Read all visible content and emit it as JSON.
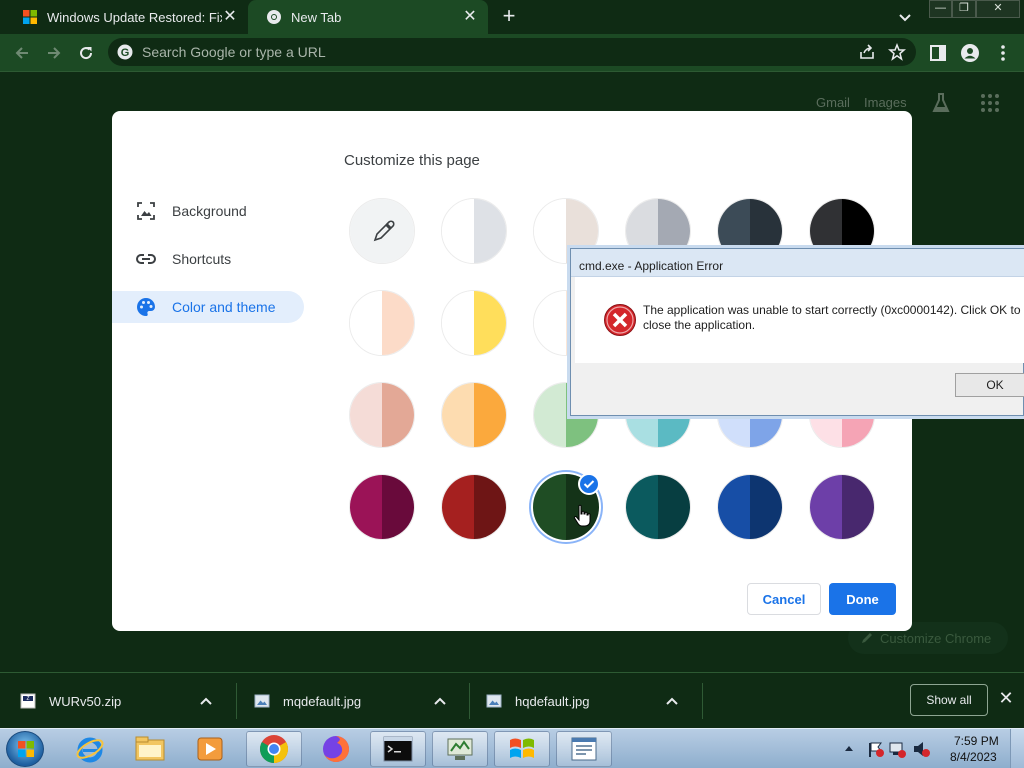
{
  "browser": {
    "tabs": [
      {
        "title": "Windows Update Restored: Fix W",
        "active": false
      },
      {
        "title": "New Tab",
        "active": true
      }
    ],
    "window_controls": {
      "minimize": "—",
      "maximize": "❐",
      "close": "✕"
    },
    "omnibox": {
      "placeholder": "Search Google or type a URL"
    }
  },
  "ntp": {
    "gmail": "Gmail",
    "images": "Images",
    "customize_chrome": "Customize Chrome"
  },
  "customize_dialog": {
    "title": "Customize this page",
    "nav": [
      {
        "label": "Background",
        "icon": "image-icon",
        "selected": false
      },
      {
        "label": "Shortcuts",
        "icon": "link-icon",
        "selected": false
      },
      {
        "label": "Color and theme",
        "icon": "palette-icon",
        "selected": true
      }
    ],
    "swatches": [
      {
        "left": "#f1f3f4",
        "right": "#f1f3f4",
        "custom": true
      },
      {
        "left": "#ffffff",
        "right": "#dee1e6"
      },
      {
        "left": "#ffffff",
        "right": "#e9e0da"
      },
      {
        "left": "#dadce0",
        "right": "#a4a9b3"
      },
      {
        "left": "#3c4b57",
        "right": "#28323a"
      },
      {
        "left": "#303134",
        "right": "#000000"
      },
      {
        "left": "#ffffff",
        "right": "#fcdbc8"
      },
      {
        "left": "#ffffff",
        "right": "#ffde5b"
      },
      {
        "left": "#ffffff",
        "right": "#fbe7d8"
      },
      {
        "left": "#ffffff",
        "right": "#cde3f5"
      },
      {
        "left": "#ffffff",
        "right": "#d3e2fb"
      },
      {
        "left": "#ffffff",
        "right": "#fde0e6"
      },
      {
        "left": "#f5dcd7",
        "right": "#e3a896"
      },
      {
        "left": "#fddcb0",
        "right": "#fba93d"
      },
      {
        "left": "#d2ead3",
        "right": "#7ec17f"
      },
      {
        "left": "#a9dfe2",
        "right": "#5bbac3"
      },
      {
        "left": "#d0dffb",
        "right": "#7ea4e8"
      },
      {
        "left": "#fde0e6",
        "right": "#f5a4b5"
      },
      {
        "left": "#9b1357",
        "right": "#690a3b"
      },
      {
        "left": "#a5201f",
        "right": "#6e1515"
      },
      {
        "left": "#1f4d24",
        "right": "#143318",
        "selected": true
      },
      {
        "left": "#0b5a5e",
        "right": "#073e41"
      },
      {
        "left": "#174ea6",
        "right": "#0d3570"
      },
      {
        "left": "#6d3fa8",
        "right": "#48286e"
      }
    ],
    "cancel_label": "Cancel",
    "done_label": "Done"
  },
  "error_dialog": {
    "title": "cmd.exe - Application Error",
    "message": "The application was unable to start correctly (0xc0000142). Click OK to close the application.",
    "ok_label": "OK"
  },
  "downloads": {
    "items": [
      {
        "name": "WURv50.zip",
        "icon": "zip-file-icon"
      },
      {
        "name": "mqdefault.jpg",
        "icon": "image-file-icon"
      },
      {
        "name": "hqdefault.jpg",
        "icon": "image-file-icon"
      }
    ],
    "show_all_label": "Show all"
  },
  "taskbar": {
    "apps": [
      {
        "name": "internet-explorer-icon",
        "active": false
      },
      {
        "name": "file-explorer-icon",
        "active": false
      },
      {
        "name": "media-player-icon",
        "active": false
      },
      {
        "name": "chrome-icon",
        "active": true
      },
      {
        "name": "firefox-icon",
        "active": false
      },
      {
        "name": "cmd-icon",
        "active": true
      },
      {
        "name": "network-tool-icon",
        "active": true
      },
      {
        "name": "windows-update-icon",
        "active": true
      },
      {
        "name": "document-app-icon",
        "active": true
      }
    ],
    "clock": {
      "time": "7:59 PM",
      "date": "8/4/2023"
    }
  }
}
